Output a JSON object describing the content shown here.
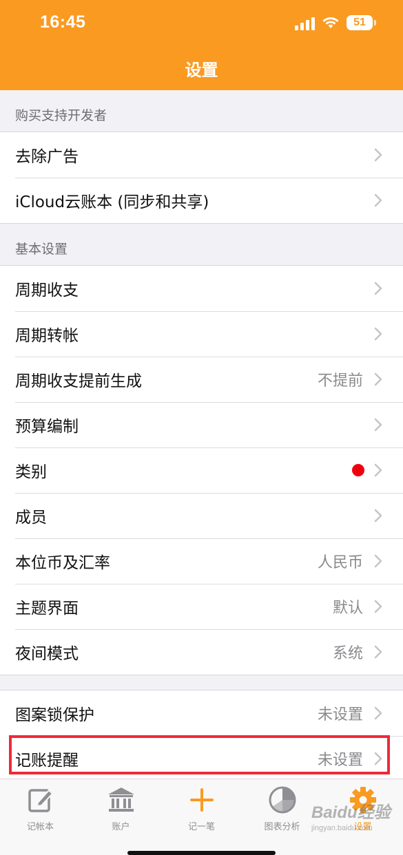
{
  "status_bar": {
    "time": "16:45",
    "battery": "51"
  },
  "header": {
    "title": "设置"
  },
  "sections": [
    {
      "header": "购买支持开发者",
      "rows": [
        {
          "label": "去除广告",
          "value": ""
        },
        {
          "label": "iCloud云账本 (同步和共享)",
          "value": ""
        }
      ]
    },
    {
      "header": "基本设置",
      "rows": [
        {
          "label": "周期收支",
          "value": ""
        },
        {
          "label": "周期转帐",
          "value": ""
        },
        {
          "label": "周期收支提前生成",
          "value": "不提前"
        },
        {
          "label": "预算编制",
          "value": ""
        },
        {
          "label": "类别",
          "value": "",
          "badge": "red-dot"
        },
        {
          "label": "成员",
          "value": ""
        },
        {
          "label": "本位币及汇率",
          "value": "人民币"
        },
        {
          "label": "主题界面",
          "value": "默认"
        },
        {
          "label": "夜间模式",
          "value": "系统"
        }
      ]
    },
    {
      "header": "",
      "rows": [
        {
          "label": "图案锁保护",
          "value": "未设置"
        },
        {
          "label": "记账提醒",
          "value": "未设置"
        }
      ]
    }
  ],
  "tabbar": [
    {
      "label": "记帐本",
      "icon": "notebook-edit-icon",
      "active": false
    },
    {
      "label": "账户",
      "icon": "bank-icon",
      "active": false
    },
    {
      "label": "记一笔",
      "icon": "plus-icon",
      "active": false
    },
    {
      "label": "图表分析",
      "icon": "pie-chart-icon",
      "active": false
    },
    {
      "label": "设置",
      "icon": "gear-icon",
      "active": true
    }
  ],
  "watermark": {
    "main": "Baidu经验",
    "sub": "jingyan.baidu.com"
  },
  "colors": {
    "accent": "#fa9a21",
    "badge_red": "#f0000d",
    "highlight_border": "#ed2a3a",
    "secondary_text": "#8a8a8e"
  }
}
